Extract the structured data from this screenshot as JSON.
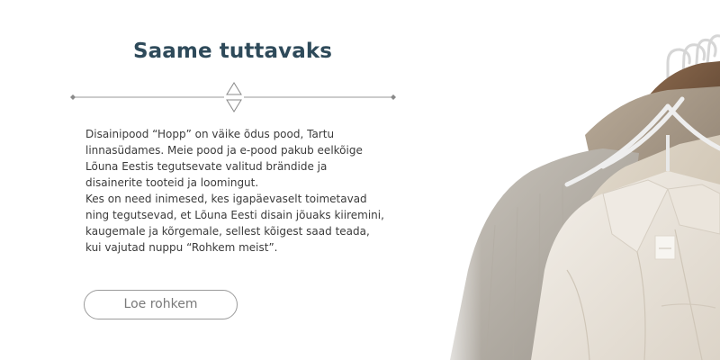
{
  "about": {
    "heading": "Saame tuttavaks",
    "paragraph_1": "Disainipood “Hopp” on väike õdus pood, Tartu\nlinnasüdames. Meie pood ja e-pood pakub  eelkõige\nLõuna Eestis tegutsevate valitud brändide ja\ndisainerite tooteid ja loomingut.",
    "paragraph_2": "Kes on need inimesed, kes igapäevaselt toimetavad\nning tegutsevad, et Lõuna Eesti disain jõuaks kiiremini,\nkaugemale ja kõrgemale, sellest kõigest saad teada,\nkui vajutad nuppu “Rohkem meist”.",
    "button_label": "Loe rohkem"
  },
  "colors": {
    "heading": "#2e4a5a",
    "body_text": "#3b3b3b",
    "divider": "#9a9a9a",
    "button_border": "#9b9b9b",
    "button_text": "#7a7a7a"
  },
  "icons": {
    "divider_ornament": "triangle-up-down-icon",
    "divider_end": "diamond-icon"
  },
  "image": {
    "subject": "clothes-on-hangers-photo"
  }
}
